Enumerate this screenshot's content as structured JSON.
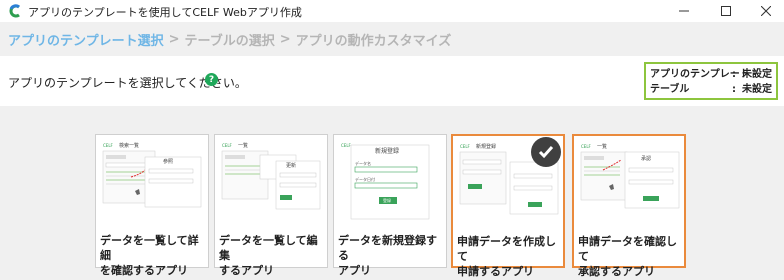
{
  "window": {
    "title": "アプリのテンプレートを使用してCELF Webアプリ作成"
  },
  "breadcrumb": {
    "steps": [
      "アプリのテンプレート選択",
      "テーブルの選択",
      "アプリの動作カスタマイズ"
    ],
    "separator": ">"
  },
  "header": {
    "instruction": "アプリのテンプレートを選択してください。",
    "help": "?"
  },
  "status": {
    "template_label": "アプリのテンプレート",
    "template_value": "未設定",
    "table_label": "テーブル",
    "table_value": "未設定",
    "colon": ":"
  },
  "cards": [
    {
      "line1": "データを一覧して詳細",
      "line2": "を確認するアプリ",
      "selected": false,
      "thumb": "list-detail"
    },
    {
      "line1": "データを一覧して編集",
      "line2": "するアプリ",
      "selected": false,
      "thumb": "list-edit"
    },
    {
      "line1": "データを新規登録する",
      "line2": "アプリ",
      "selected": false,
      "thumb": "new-register"
    },
    {
      "line1": "申請データを作成して",
      "line2": "申請するアプリ",
      "selected": true,
      "checked": true,
      "thumb": "apply"
    },
    {
      "line1": "申請データを確認して",
      "line2": "承認するアプリ",
      "selected": true,
      "checked": false,
      "thumb": "approve"
    }
  ],
  "thumbs": {
    "list_title": "検索一覧",
    "list_title2": "一覧",
    "detail_title": "参照",
    "edit_title": "更新",
    "new_title": "新規登録",
    "apply_title": "新規登録",
    "approve_title": "承認",
    "save": "登録",
    "field_name": "データ名",
    "field_date": "データ日付"
  },
  "colors": {
    "accent": "#6fb6e6",
    "selection": "#ea8a3c",
    "status_border": "#8dc53e",
    "help": "#1fa85a"
  }
}
